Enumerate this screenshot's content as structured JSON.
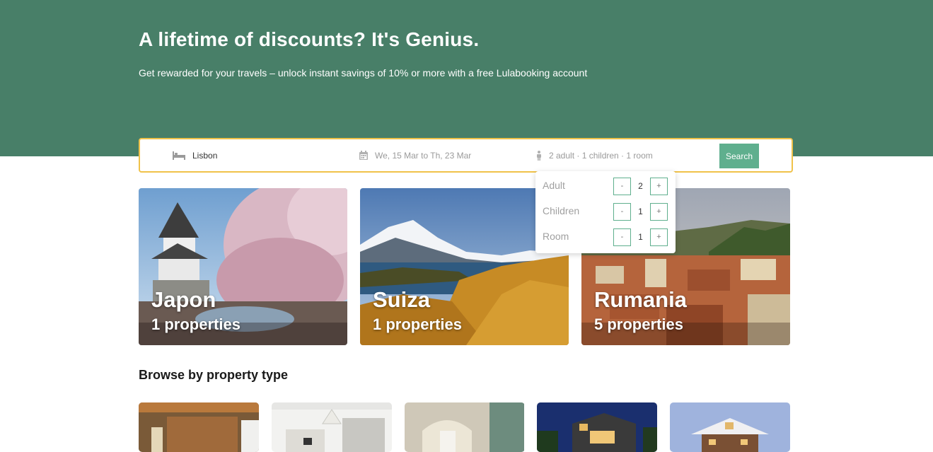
{
  "hero": {
    "title": "A lifetime of discounts? It's Genius.",
    "subtitle": "Get rewarded for your travels – unlock instant savings of 10% or more with a free Lulabooking account"
  },
  "search": {
    "destination": "Lisbon",
    "dates": "We, 15 Mar to Th, 23 Mar",
    "guests": "2 adult · 1 children · 1 room",
    "button_label": "Search"
  },
  "guest_picker": {
    "rows": [
      {
        "label": "Adult",
        "value": "2",
        "minus": "-",
        "plus": "+"
      },
      {
        "label": "Children",
        "value": "1",
        "minus": "-",
        "plus": "+"
      },
      {
        "label": "Room",
        "value": "1",
        "minus": "-",
        "plus": "+"
      }
    ]
  },
  "destinations": [
    {
      "name": "Japon",
      "count": "1 properties"
    },
    {
      "name": "Suiza",
      "count": "1 properties"
    },
    {
      "name": "Rumania",
      "count": "5 properties"
    }
  ],
  "property_types": {
    "title": "Browse by property type"
  },
  "icons": {
    "destination": "bed-icon",
    "dates": "calendar-icon",
    "guests": "person-icon"
  },
  "colors": {
    "hero": "#487f68",
    "accent": "#5faf8e",
    "search_border": "#f0c24a"
  }
}
